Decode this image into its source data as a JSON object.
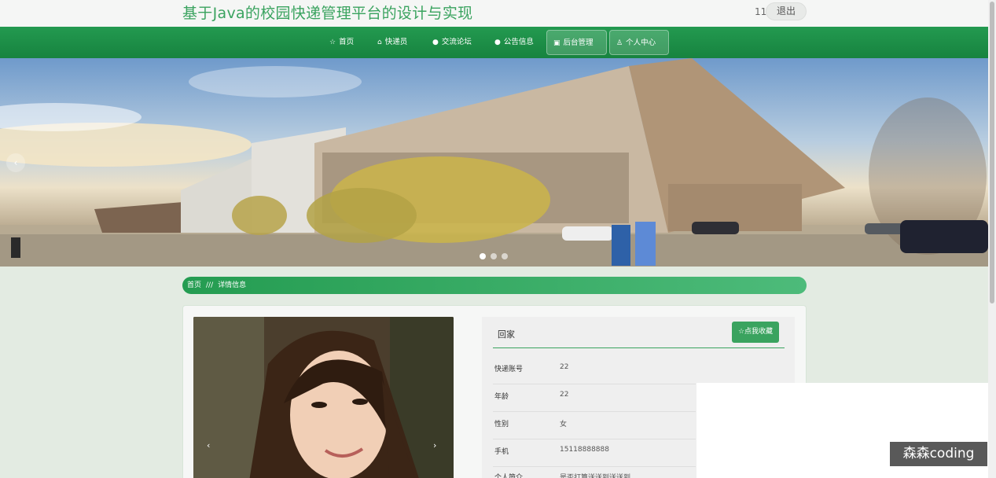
{
  "header": {
    "title": "基于Java的校园快递管理平台的设计与实现",
    "user_count": "11",
    "logout_label": "退出"
  },
  "nav": {
    "items": [
      {
        "label": "首页",
        "icon": "star-icon"
      },
      {
        "label": "快递员",
        "icon": "lock-icon"
      },
      {
        "label": "交流论坛",
        "icon": "question-icon"
      },
      {
        "label": "公告信息",
        "icon": "question-icon"
      },
      {
        "label": "后台管理",
        "icon": "box-icon"
      },
      {
        "label": "个人中心",
        "icon": "person-icon"
      }
    ]
  },
  "banner": {
    "prev_glyph": "‹",
    "slide_count": 3,
    "active_slide": 1
  },
  "breadcrumb": {
    "home": "首页",
    "separator": "///",
    "current": "详情信息"
  },
  "detail": {
    "title": "回家",
    "favorite_label": "☆点我收藏",
    "fields": [
      {
        "label": "快递账号",
        "value": "22"
      },
      {
        "label": "年龄",
        "value": "22"
      },
      {
        "label": "性别",
        "value": "女"
      },
      {
        "label": "手机",
        "value": "15118888888"
      },
      {
        "label": "个人简介",
        "value": "是否打算送送到送送到"
      }
    ],
    "photo_prev_glyph": "‹",
    "photo_next_glyph": "›"
  },
  "watermark": "森森coding",
  "colors": {
    "brand_green": "#239a50",
    "accent_green": "#3aa35f",
    "page_bg": "#e3ebe2"
  }
}
